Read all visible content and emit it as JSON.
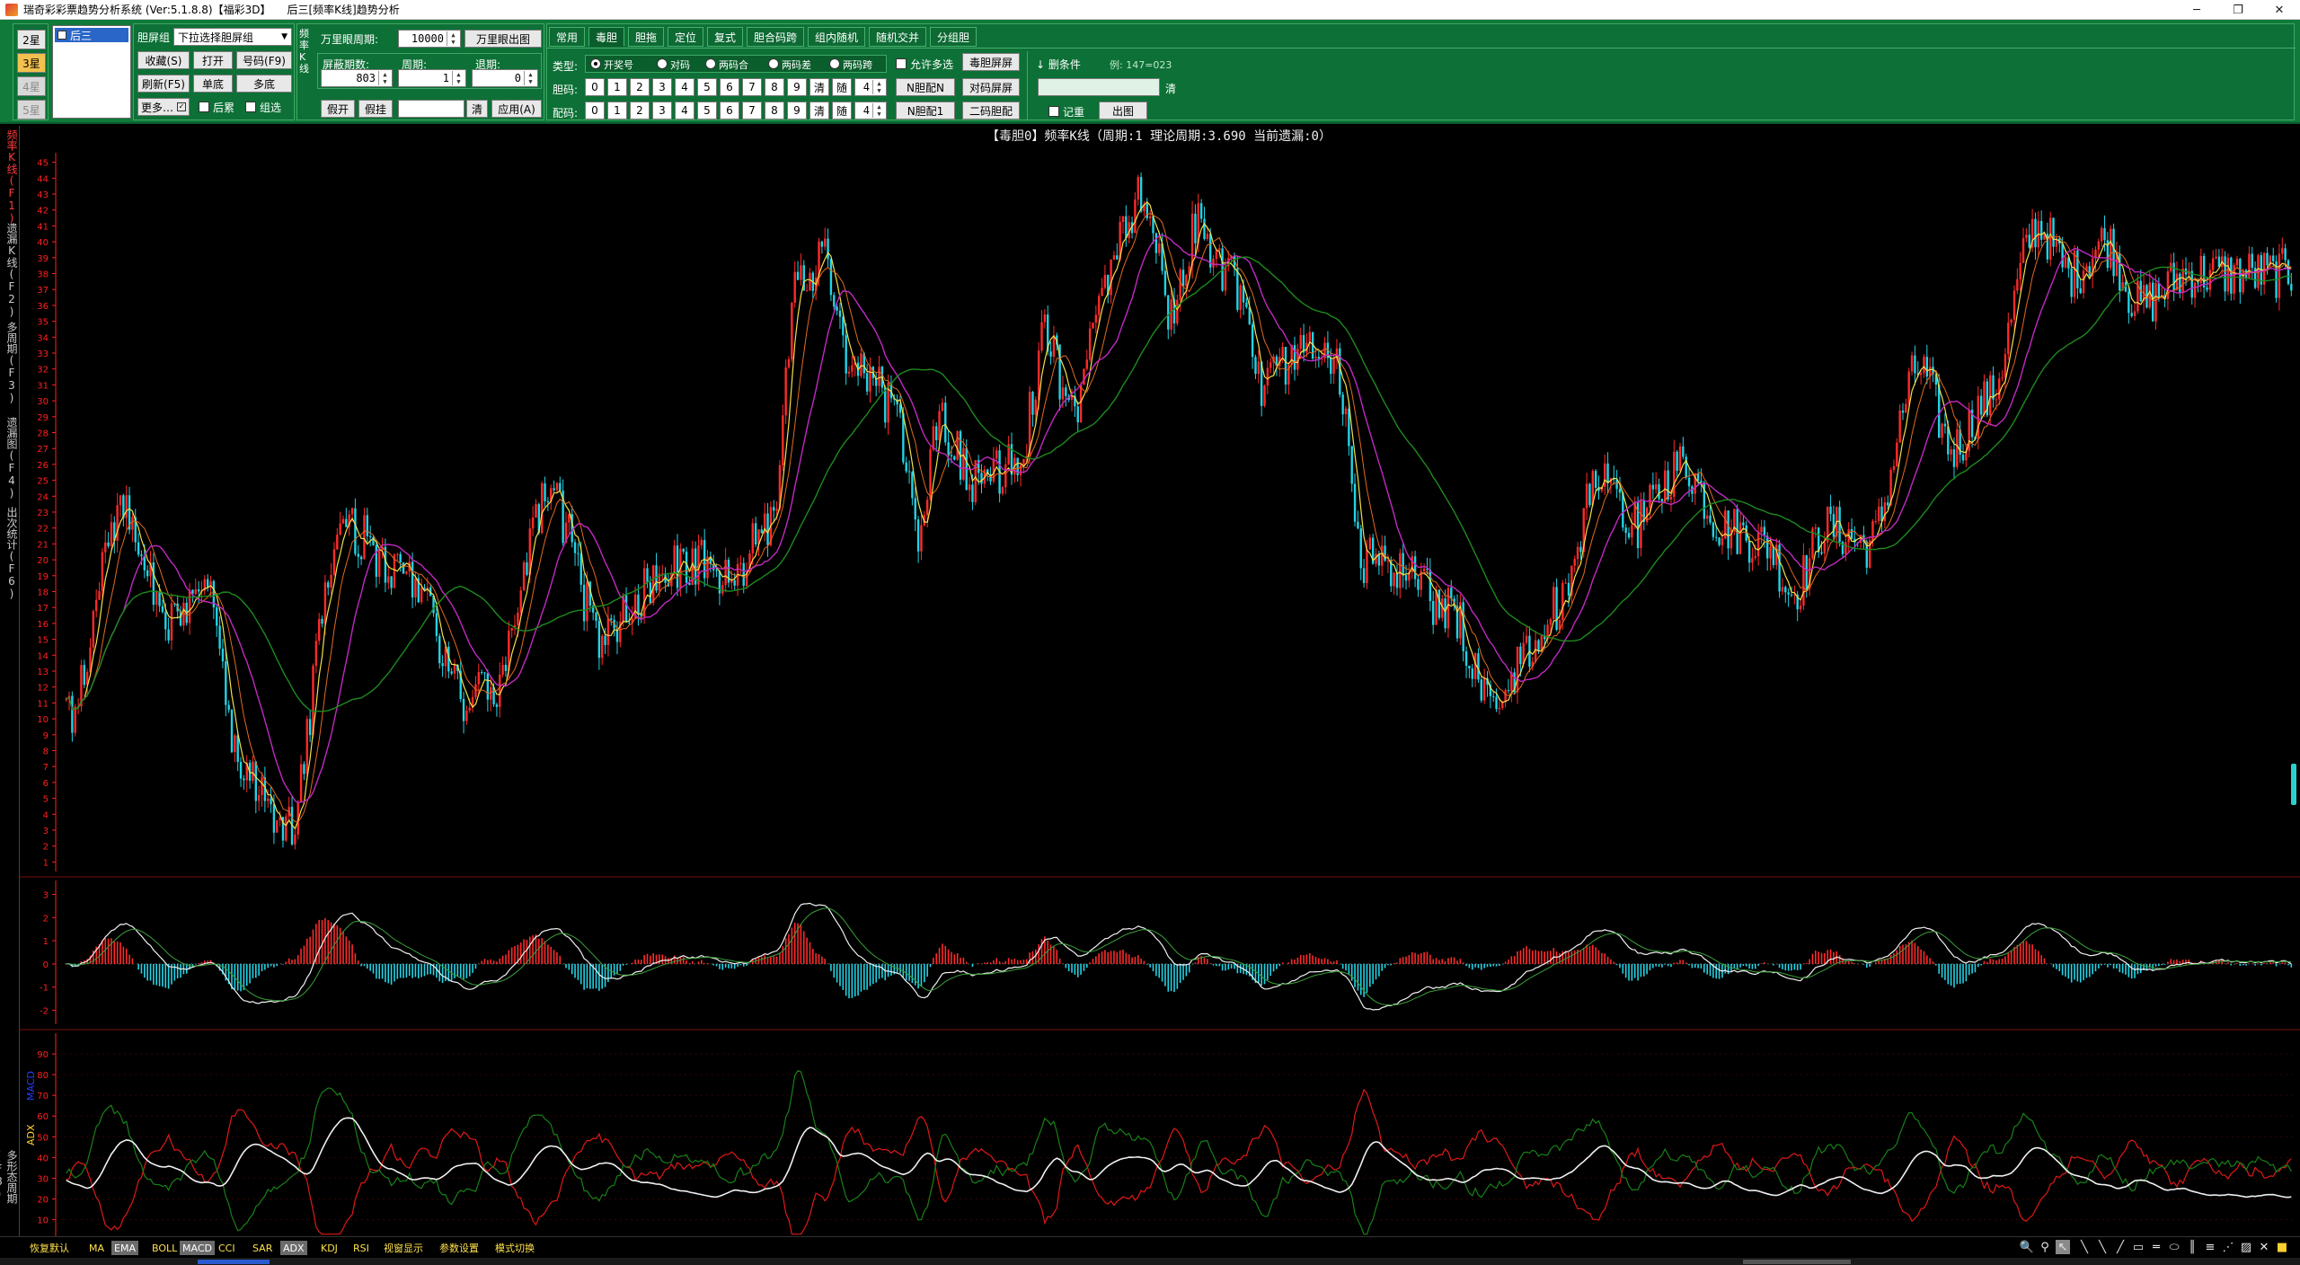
{
  "window": {
    "title": "瑞奇彩彩票趋势分析系统 (Ver:5.1.8.8)【福彩3D】",
    "subtitle": "后三[频率K线]趋势分析",
    "min": "─",
    "restore": "❐",
    "close": "✕"
  },
  "stars": {
    "s2": "2星",
    "s3": "3星",
    "s4": "4星",
    "s5": "5星"
  },
  "list": {
    "item1": "后三"
  },
  "group_panel": {
    "label": "胆屏组",
    "select_value": "下拉选择胆屏组",
    "b_collect": "收藏(S)",
    "b_open": "打开",
    "b_number": "号码(F9)",
    "b_refresh": "刷新(F5)",
    "b_single": "单底",
    "b_multi": "多底",
    "b_more": "更多…",
    "cb_dup": "后累",
    "cb_group": "组选"
  },
  "kline_panel": {
    "vert_label": "频率K线",
    "period_label": "万里眼周期:",
    "period_value": "10000",
    "period_btn": "万里眼出图",
    "count_label": "屏蔽期数:",
    "count_value": "803",
    "cycle_label": "周期:",
    "cycle_value": "1",
    "back_label": "退期:",
    "back_value": "0",
    "b_fake": "假开",
    "b_fakecode": "假挂",
    "b_clear": "清",
    "b_apply": "应用(A)"
  },
  "tabs": [
    "常用",
    "毒胆",
    "胆拖",
    "定位",
    "复式",
    "胆合码跨",
    "组内随机",
    "随机交并",
    "分组胆"
  ],
  "filter_panel": {
    "type_label": "类型:",
    "types": [
      "开奖号",
      "对码",
      "两码合",
      "两码差",
      "两码跨"
    ],
    "allow_multi": "允许多选",
    "b_poison_screen": "毒胆屏屏",
    "gall_label": "胆码:",
    "pair_label": "配码:",
    "digits": [
      "0",
      "1",
      "2",
      "3",
      "4",
      "5",
      "6",
      "7",
      "8",
      "9"
    ],
    "clear": "清",
    "rand": "随",
    "rand_count": "4",
    "b_n_gall": "N胆配N",
    "b_pair_screen": "对码屏屏",
    "b_n_one": "N胆配1",
    "b_two_gall": "二码胆配",
    "kill_label": "↓ 删条件",
    "kill_hint": "例: 147=023",
    "qing": "清",
    "cb_remember": "记重",
    "b_output": "出图"
  },
  "vtabs": {
    "t1": "频率K线(F1)",
    "t2": "遗漏K线(F2)",
    "t3": "多周期(F3)",
    "t4": "遗漏图(F4)",
    "t5": "出次统计(F6)",
    "t6": "多形态周期(F8)"
  },
  "chart": {
    "header": "【毒胆0】频率K线（周期:1 理论周期:3.690 当前遗漏:0）",
    "price_ticks": [
      "1",
      "2",
      "3",
      "4",
      "5",
      "6",
      "7",
      "8",
      "9",
      "10",
      "11",
      "12",
      "13",
      "14",
      "15",
      "16",
      "17",
      "18",
      "19",
      "20",
      "21",
      "22",
      "23",
      "24",
      "25",
      "26",
      "27",
      "28",
      "29",
      "30",
      "31",
      "32",
      "33",
      "34",
      "35",
      "36",
      "37",
      "38",
      "39",
      "40",
      "41",
      "42",
      "43",
      "44",
      "45"
    ],
    "macd_label": "MACD",
    "macd_ticks": [
      "-2",
      "-1",
      "0",
      "1",
      "2",
      "3"
    ],
    "adx_label": "ADX",
    "adx_ticks": [
      "10",
      "20",
      "30",
      "40",
      "50",
      "60",
      "70",
      "80",
      "90"
    ]
  },
  "bottom": {
    "items": [
      "恢复默认",
      "MA",
      "EMA",
      "BOLL",
      "MACD",
      "CCI",
      "SAR",
      "ADX",
      "KDJ",
      "RSI",
      "视窗显示",
      "参数设置",
      "模式切换"
    ]
  },
  "colors": {
    "green_bar": "#0f7a3a",
    "up": "#ff2a2a",
    "down": "#22d3e6",
    "ma_yellow": "#f2e04a",
    "ma_purple": "#c02ac0",
    "ma_green": "#1e8a1e",
    "axis_red": "#ff2020",
    "adx_red": "#e01818",
    "adx_green": "#188018",
    "adx_white": "#f0f0f0"
  }
}
